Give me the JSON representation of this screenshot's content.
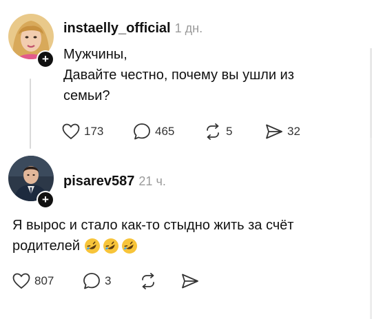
{
  "post": {
    "username": "instaelly_official",
    "time": "1 дн.",
    "lines": [
      "Мужчины,",
      "Давайте честно, почему вы ушли из",
      "семьи?"
    ],
    "likes": "173",
    "comments": "465",
    "reposts": "5",
    "shares": "32"
  },
  "reply": {
    "username": "pisarev587",
    "time": "21 ч.",
    "line1": "Я вырос и стало как-то стыдно жить за счёт",
    "line2": "родителей",
    "emoji_icon": "rolling-on-floor-laughing-emoji",
    "likes": "807",
    "comments": "3"
  },
  "colors": {
    "text": "#111111",
    "muted": "#9a9a9a",
    "thread_line": "#d9d9d9",
    "emoji": "#f7c43a"
  }
}
